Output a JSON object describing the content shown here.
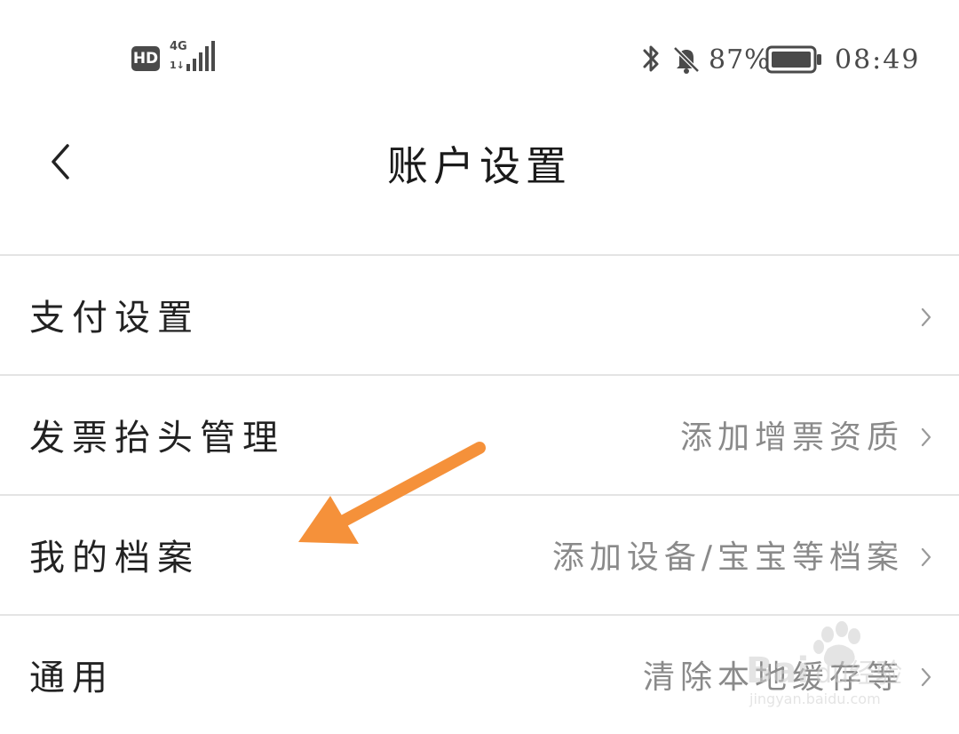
{
  "status_bar": {
    "hd_badge": "HD",
    "network_type": "4G",
    "battery_percent": "87%",
    "time": "08:49",
    "icons": [
      "signal-icon",
      "bluetooth-icon",
      "bell-off-icon",
      "battery-icon"
    ]
  },
  "header": {
    "title": "账户设置",
    "back_icon": "back-chevron-icon"
  },
  "settings": {
    "items": [
      {
        "label": "支付设置",
        "hint": ""
      },
      {
        "label": "发票抬头管理",
        "hint": "添加增票资质"
      },
      {
        "label": "我的档案",
        "hint": "添加设备/宝宝等档案"
      },
      {
        "label": "通用",
        "hint": "清除本地缓存等"
      }
    ]
  },
  "annotation": {
    "color": "#F5913A",
    "points_to": "我的档案"
  },
  "watermark": {
    "text": "Baidu经验",
    "subtext": "jingyan.baidu.com"
  },
  "colors": {
    "background": "#FFFFFF",
    "divider": "#E4E4E4",
    "hint_text": "#8A8A8A",
    "primary_text": "#222222"
  }
}
